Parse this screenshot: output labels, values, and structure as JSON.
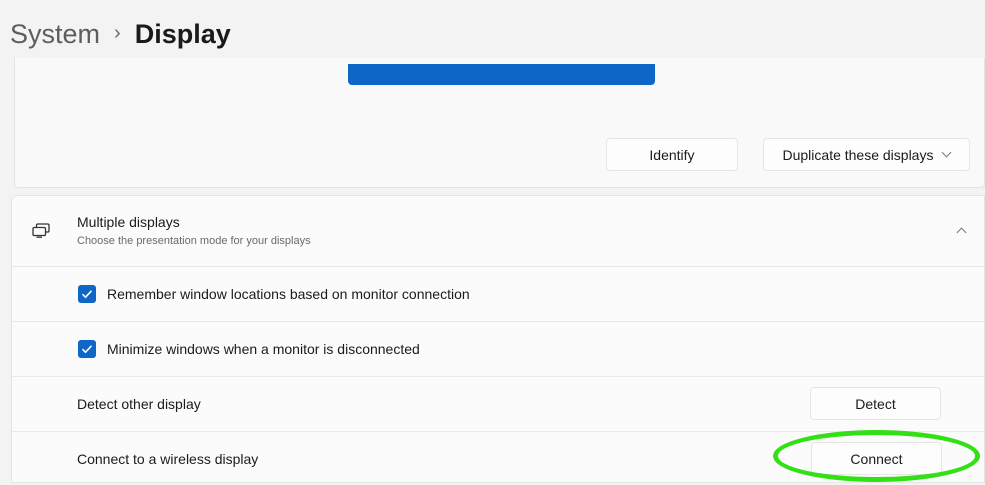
{
  "breadcrumb": {
    "parent": "System",
    "separator": "›",
    "current": "Display"
  },
  "arrangement": {
    "monitor_color": "#0e67c6",
    "identify_label": "Identify",
    "mode_value": "Duplicate these displays"
  },
  "multiple_displays": {
    "icon": "displays-icon",
    "title": "Multiple displays",
    "subtitle": "Choose the presentation mode for your displays",
    "expanded": true,
    "options": [
      {
        "label": "Remember window locations based on monitor connection",
        "checked": true
      },
      {
        "label": "Minimize windows when a monitor is disconnected",
        "checked": true
      }
    ],
    "detect": {
      "label": "Detect other display",
      "button": "Detect"
    },
    "wireless": {
      "label": "Connect to a wireless display",
      "button": "Connect"
    }
  },
  "annotation": {
    "color": "#33e016",
    "target": "Connect"
  }
}
